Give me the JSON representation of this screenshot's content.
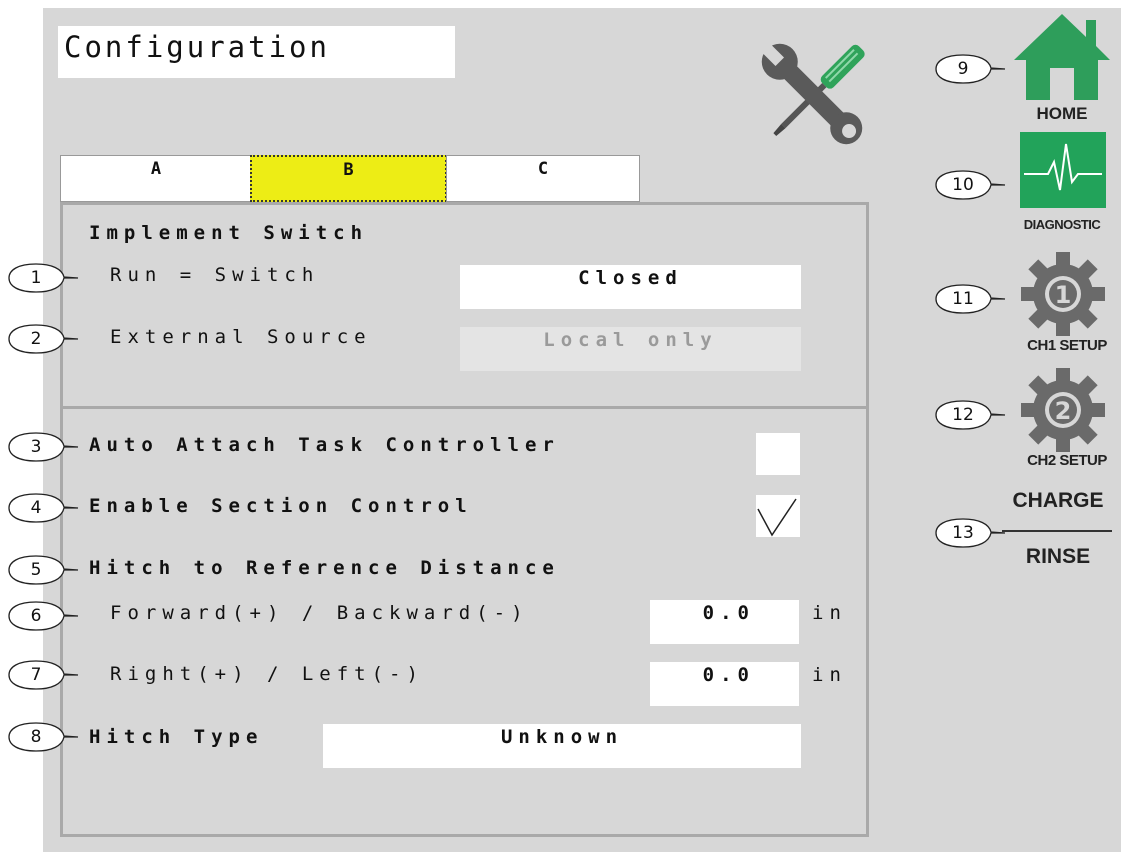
{
  "screen_title": "Configuration",
  "tabs": [
    {
      "label": "A",
      "active": false
    },
    {
      "label": "B",
      "active": true
    },
    {
      "label": "C",
      "active": false
    }
  ],
  "implement_switch": {
    "heading": "Implement Switch",
    "run_label": "Run = Switch",
    "run_value": "Closed",
    "external_label": "External Source",
    "external_value": "Local only"
  },
  "options": {
    "auto_attach_label": "Auto Attach Task Controller",
    "auto_attach_checked": false,
    "section_control_label": "Enable Section Control",
    "section_control_checked": true
  },
  "hitch_distance": {
    "heading": "Hitch to Reference Distance",
    "forward_label": "Forward(+) / Backward(-)",
    "forward_value": "0.0",
    "forward_unit": "in",
    "right_label": "Right(+) / Left(-)",
    "right_value": "0.0",
    "right_unit": "in"
  },
  "hitch_type": {
    "label": "Hitch Type",
    "value": "Unknown"
  },
  "nav": {
    "home": "HOME",
    "diagnostic": "DIAGNOSTIC",
    "ch1_setup": "CH1 SETUP",
    "ch1_number": "1",
    "ch2_setup": "CH2 SETUP",
    "ch2_number": "2",
    "charge": "CHARGE",
    "rinse": "RINSE"
  },
  "callouts": [
    "1",
    "2",
    "3",
    "4",
    "5",
    "6",
    "7",
    "8",
    "9",
    "10",
    "11",
    "12",
    "13"
  ],
  "colors": {
    "background": "#d7d7d7",
    "active_tab": "#eded15",
    "home_green": "#2e9e5b",
    "diagnostic_green": "#22a35a",
    "gear_gray": "#6a6a6a",
    "screwdriver_green": "#2fa35a",
    "wrench_gray": "#555555"
  },
  "icons": [
    "tools-icon",
    "home-icon",
    "diagnostic-icon",
    "gear-1-icon",
    "gear-2-icon"
  ]
}
